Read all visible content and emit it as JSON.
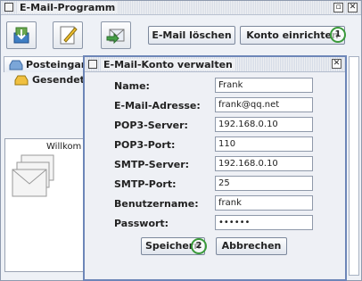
{
  "window": {
    "title": "E-Mail-Programm"
  },
  "toolbar": {
    "delete_label": "E-Mail löschen",
    "account_label": "Konto einrichten",
    "step_marker_1": "1"
  },
  "folders": [
    {
      "label": "Posteingang"
    },
    {
      "label": "Gesendete"
    }
  ],
  "content": {
    "welcome_text": "Willkom"
  },
  "dialog": {
    "title": "E-Mail-Konto verwalten",
    "fields": [
      {
        "label": "Name:",
        "value": "Frank"
      },
      {
        "label": "E-Mail-Adresse:",
        "value": "frank@qq.net"
      },
      {
        "label": "POP3-Server:",
        "value": "192.168.0.10"
      },
      {
        "label": "POP3-Port:",
        "value": "110"
      },
      {
        "label": "SMTP-Server:",
        "value": "192.168.0.10"
      },
      {
        "label": "SMTP-Port:",
        "value": "25"
      },
      {
        "label": "Benutzername:",
        "value": "frank"
      },
      {
        "label": "Passwort:",
        "value": "••••••"
      }
    ],
    "save_label": "Speichern",
    "cancel_label": "Abbrechen",
    "step_marker_2": "2"
  }
}
